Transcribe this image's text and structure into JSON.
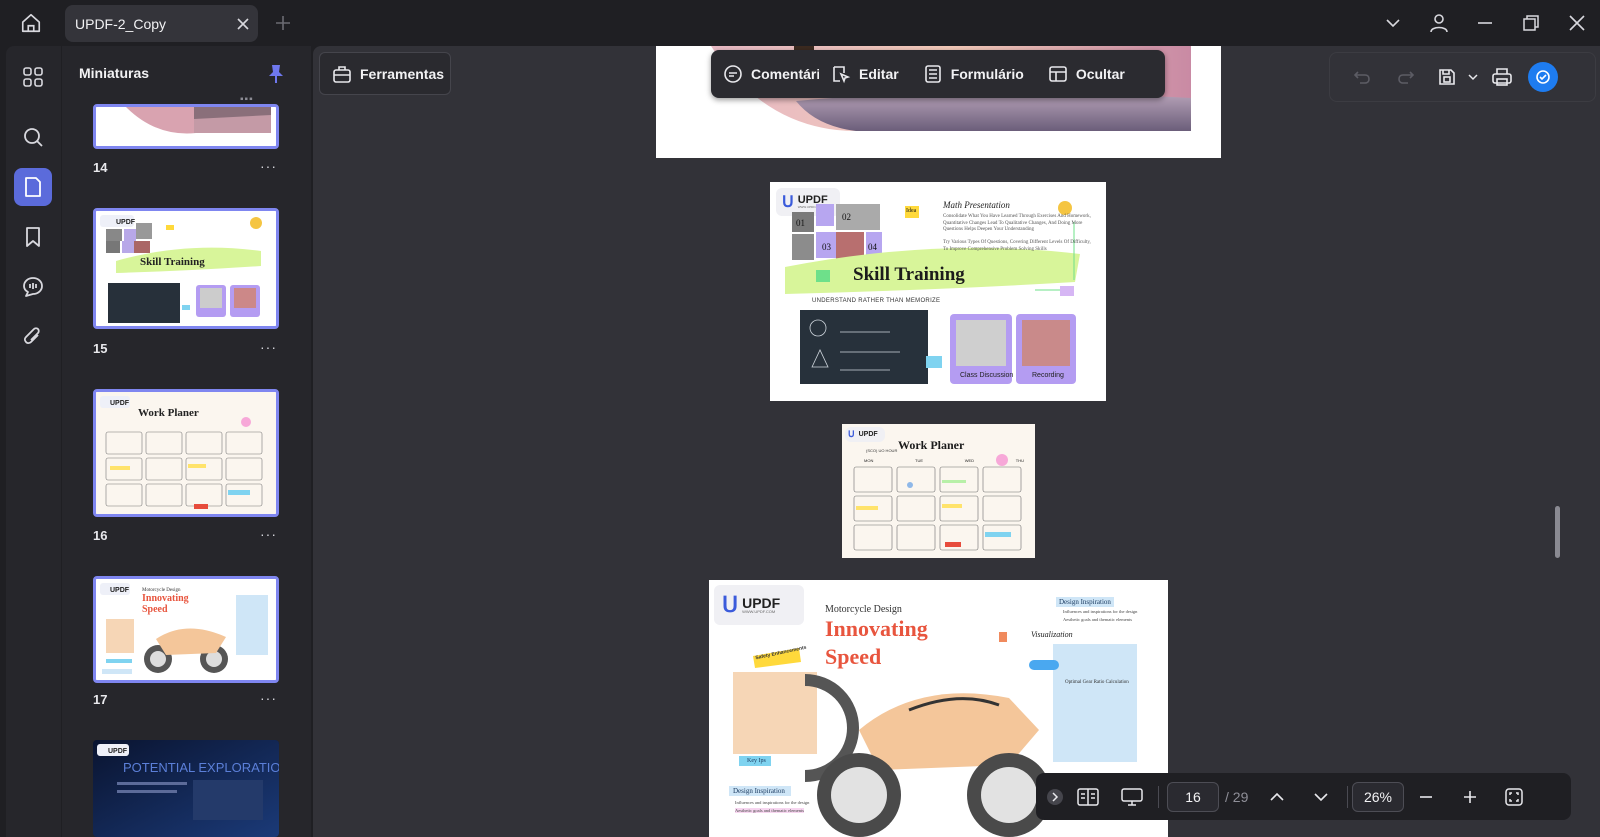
{
  "app": {
    "tab_title": "UPDF-2_Copy"
  },
  "sidebar": {
    "heading": "Miniaturas",
    "thumbnails": [
      {
        "number": "14"
      },
      {
        "number": "15"
      },
      {
        "number": "16"
      },
      {
        "number": "17"
      },
      {
        "number": ""
      }
    ],
    "more_glyph": "···"
  },
  "toolbar": {
    "tools_label": "Ferramentas",
    "comment_label": "Comentário",
    "edit_label": "Editar",
    "form_label": "Formulário",
    "hide_label": "Ocultar"
  },
  "slides": {
    "logo_text": "UPDF",
    "logo_sub": "WWW.UPDF.COM",
    "skill": {
      "heading": "Math Presentation",
      "title": "Skill Training",
      "subtitle": "UNDERSTAND RATHER THAN MEMORIZE",
      "tag_idea": "Idea",
      "caption_1": "Class Discussion",
      "caption_2": "Recording",
      "para_1": "Consolidate What You Have Learned Through Exercises And Homework, Quantitative Changes Lead To Qualitative Changes, And Doing More Questions Helps Deepen Your Understanding",
      "para_2": "Try Various Types Of Questions, Covering Different Levels Of Difficulty, To Improve Comprehensive Problem Solving Skills",
      "num_01": "01",
      "num_02": "02",
      "num_03": "03",
      "num_04": "04"
    },
    "planner": {
      "title": "Work Planer",
      "subtitle": "(SCO) UO HOUR",
      "days": [
        "MON",
        "TUE",
        "WED",
        "THU"
      ]
    },
    "moto": {
      "small_title": "Motorcycle Design",
      "title_1": "Innovating",
      "title_2": "Speed",
      "design_inspiration": "Design Inspiration",
      "bullet_1": "Influences and inspirations for the design",
      "bullet_2": "Aesthetic goals and thematic elements",
      "visualization": "Visualization",
      "safety": "Safety Enhancements",
      "key_ips": "Key Ips",
      "optimal": "Optimal Gear Ratio Calculation"
    },
    "potential": {
      "title": "POTENTIAL EXPLORATION",
      "subtitle": "Unleashing The Power Of Technology"
    }
  },
  "bottombar": {
    "current_page": "16",
    "total_pages": "/ 29",
    "zoom": "26%"
  },
  "colors": {
    "accent": "#5b6bdb",
    "selection_border": "#7f86f0",
    "ai_button": "#1e7cf0"
  }
}
